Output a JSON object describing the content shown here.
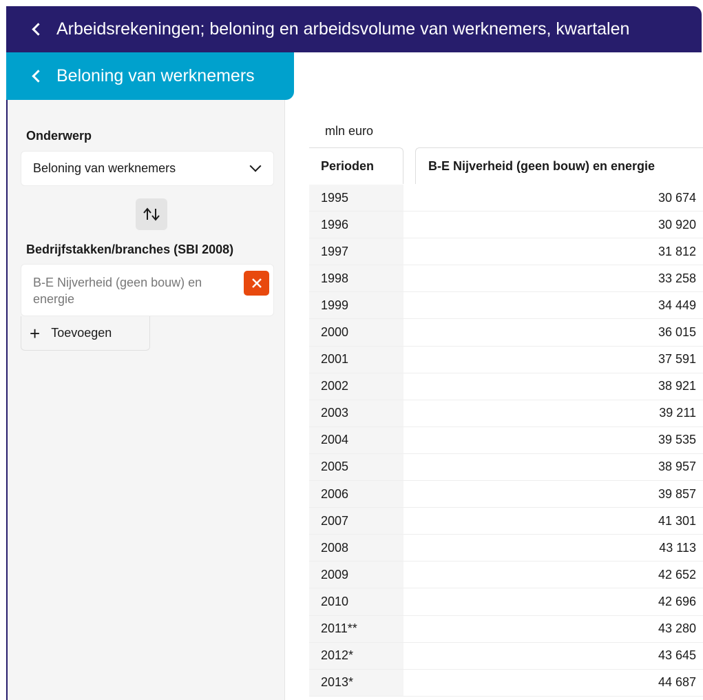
{
  "header": {
    "title": "Arbeidsrekeningen; beloning en arbeidsvolume van werknemers, kwartalen"
  },
  "subheader": {
    "title": "Beloning van werknemers"
  },
  "sidebar": {
    "topic_label": "Onderwerp",
    "topic_value": "Beloning van werknemers",
    "dimension_label": "Bedrijfstakken/branches (SBI 2008)",
    "selected_filter": "B-E Nijverheid (geen bouw) en energie",
    "add_label": "Toevoegen"
  },
  "table": {
    "unit": "mln euro",
    "period_header": "Perioden",
    "column_header": "B-E Nijverheid (geen bouw) en energie",
    "rows": [
      {
        "period": "1995",
        "value": "30 674"
      },
      {
        "period": "1996",
        "value": "30 920"
      },
      {
        "period": "1997",
        "value": "31 812"
      },
      {
        "period": "1998",
        "value": "33 258"
      },
      {
        "period": "1999",
        "value": "34 449"
      },
      {
        "period": "2000",
        "value": "36 015"
      },
      {
        "period": "2001",
        "value": "37 591"
      },
      {
        "period": "2002",
        "value": "38 921"
      },
      {
        "period": "2003",
        "value": "39 211"
      },
      {
        "period": "2004",
        "value": "39 535"
      },
      {
        "period": "2005",
        "value": "38 957"
      },
      {
        "period": "2006",
        "value": "39 857"
      },
      {
        "period": "2007",
        "value": "41 301"
      },
      {
        "period": "2008",
        "value": "43 113"
      },
      {
        "period": "2009",
        "value": "42 652"
      },
      {
        "period": "2010",
        "value": "42 696"
      },
      {
        "period": "2011**",
        "value": "43 280"
      },
      {
        "period": "2012*",
        "value": "43 645"
      },
      {
        "period": "2013*",
        "value": "44 687"
      }
    ]
  },
  "colors": {
    "primary_dark": "#271d6c",
    "accent_blue": "#00a1cd",
    "remove_orange": "#e8490e"
  }
}
